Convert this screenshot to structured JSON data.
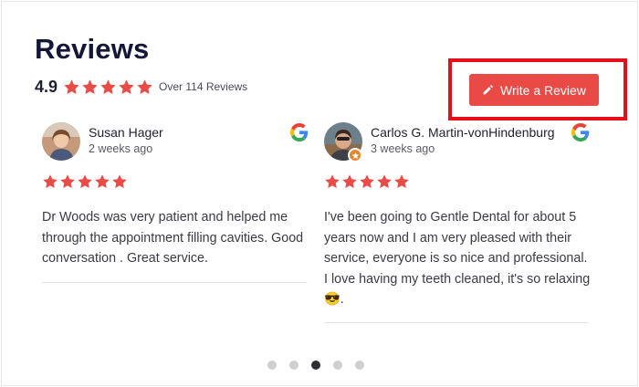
{
  "widget": {
    "title": "Reviews",
    "average_rating": "4.9",
    "rating_value": 4.9,
    "rating_max": 5,
    "review_count_label": "Over 114 Reviews"
  },
  "actions": {
    "write_review_label": "Write a Review",
    "write_review_icon": "pencil-icon"
  },
  "colors": {
    "star": "#e94b47",
    "star_empty": "#555555",
    "button_bg": "#ea4a45",
    "highlight_border": "#e3101b",
    "active_dot": "#2f2f33",
    "inactive_dot": "#cfcfd2"
  },
  "reviews": [
    {
      "name": "Susan Hager",
      "time": "2 weeks ago",
      "rating": 5,
      "source_icon": "google-logo-icon",
      "text": "Dr Woods was very patient and helped me through the appointment filling cavities. Good conversation . Great service."
    },
    {
      "name": "Carlos G. Martin-vonHindenburg",
      "time": "3 weeks ago",
      "rating": 5,
      "source_icon": "google-logo-icon",
      "badge_icon": "local-guide-star-icon",
      "text": "I've been going to Gentle Dental for about 5 years now and I am very pleased with their service, everyone is so nice and professional. I love having my teeth cleaned, it's so relaxing 😎."
    }
  ],
  "pagination": {
    "total": 5,
    "active_index": 2
  }
}
